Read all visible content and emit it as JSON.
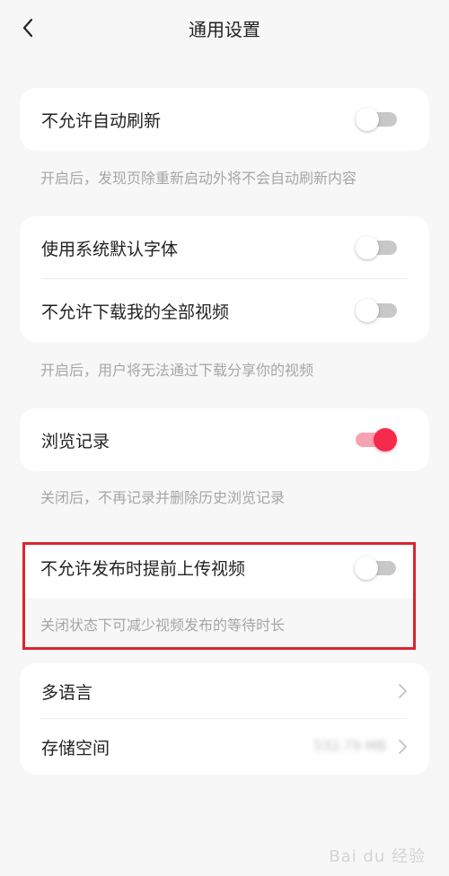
{
  "header": {
    "title": "通用设置"
  },
  "sections": {
    "auto_refresh": {
      "label": "不允许自动刷新",
      "toggle_on": false,
      "description": "开启后，发现页除重新启动外将不会自动刷新内容"
    },
    "font_download": {
      "system_font_label": "使用系统默认字体",
      "system_font_on": false,
      "download_label": "不允许下载我的全部视频",
      "download_on": false,
      "description": "开启后，用户将无法通过下载分享你的视频"
    },
    "history": {
      "label": "浏览记录",
      "toggle_on": true,
      "description": "关闭后，不再记录并删除历史浏览记录"
    },
    "pre_upload": {
      "label": "不允许发布时提前上传视频",
      "toggle_on": false,
      "description": "关闭状态下可减少视频发布的等待时长"
    },
    "misc": {
      "language_label": "多语言",
      "storage_label": "存储空间",
      "storage_value": "532.79 MB"
    }
  },
  "watermark": "Bai du 经验",
  "colors": {
    "accent": "#f52a4c",
    "highlight_border": "#d9252f",
    "toggle_off": "#c8c8c8"
  }
}
